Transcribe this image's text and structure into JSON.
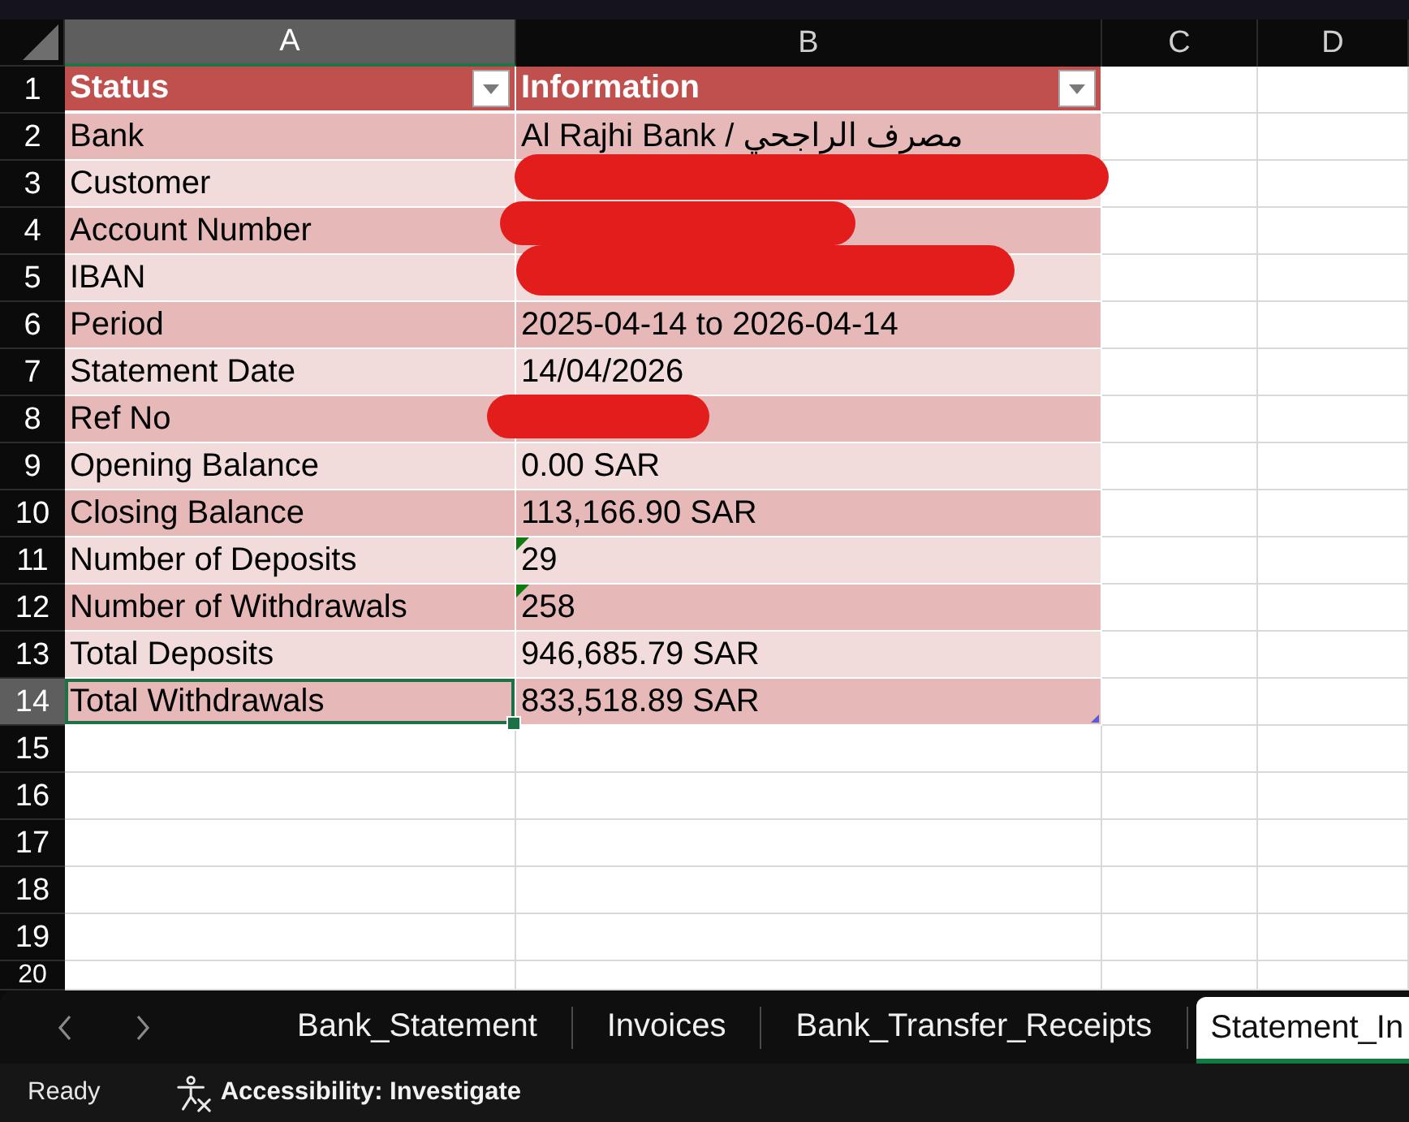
{
  "columns": [
    {
      "label": "A",
      "selected": true
    },
    {
      "label": "B",
      "selected": false
    },
    {
      "label": "C",
      "selected": false
    },
    {
      "label": "D",
      "selected": false
    }
  ],
  "rows": [
    {
      "kind": "header",
      "number": "1",
      "selected": false,
      "status": "Status",
      "information": "Information"
    },
    {
      "kind": "data",
      "number": "2",
      "selected": false,
      "status": "Bank",
      "information": "Al Rajhi Bank / مصرف الراجحي",
      "redacted": false,
      "number_as_text": false
    },
    {
      "kind": "data",
      "number": "3",
      "selected": false,
      "status": "Customer",
      "redacted": true,
      "number_as_text": false
    },
    {
      "kind": "data",
      "number": "4",
      "selected": false,
      "status": "Account Number",
      "redacted": true,
      "number_as_text": false
    },
    {
      "kind": "data",
      "number": "5",
      "selected": false,
      "status": "IBAN",
      "redacted": true,
      "number_as_text": false
    },
    {
      "kind": "data",
      "number": "6",
      "selected": false,
      "status": "Period",
      "information": "2025-04-14 to 2026-04-14",
      "redacted": false,
      "number_as_text": false
    },
    {
      "kind": "data",
      "number": "7",
      "selected": false,
      "status": "Statement Date",
      "information": "14/04/2026",
      "redacted": false,
      "number_as_text": false
    },
    {
      "kind": "data",
      "number": "8",
      "selected": false,
      "status": "Ref No",
      "redacted": true,
      "number_as_text": false
    },
    {
      "kind": "data",
      "number": "9",
      "selected": false,
      "status": "Opening Balance",
      "information": "0.00 SAR",
      "redacted": false,
      "number_as_text": false
    },
    {
      "kind": "data",
      "number": "10",
      "selected": false,
      "status": "Closing Balance",
      "information": "113,166.90 SAR",
      "redacted": false,
      "number_as_text": false
    },
    {
      "kind": "data",
      "number": "11",
      "selected": false,
      "status": "Number of Deposits",
      "information": "29",
      "redacted": false,
      "number_as_text": true
    },
    {
      "kind": "data",
      "number": "12",
      "selected": false,
      "status": "Number of Withdrawals",
      "information": "258",
      "redacted": false,
      "number_as_text": true
    },
    {
      "kind": "data",
      "number": "13",
      "selected": false,
      "status": "Total Deposits",
      "information": "946,685.79 SAR",
      "redacted": false,
      "number_as_text": false
    },
    {
      "kind": "data",
      "number": "14",
      "selected": true,
      "status": "Total Withdrawals",
      "information": "833,518.89 SAR",
      "redacted": false,
      "number_as_text": false
    },
    {
      "kind": "empty",
      "number": "15",
      "selected": false
    },
    {
      "kind": "empty",
      "number": "16",
      "selected": false
    },
    {
      "kind": "empty",
      "number": "17",
      "selected": false
    },
    {
      "kind": "empty",
      "number": "18",
      "selected": false
    },
    {
      "kind": "empty",
      "number": "19",
      "selected": false
    },
    {
      "kind": "empty",
      "number": "20",
      "selected": false
    }
  ],
  "sheet_tabs": [
    {
      "label": "Bank_Statement",
      "selected": false
    },
    {
      "label": "Invoices",
      "selected": false
    },
    {
      "label": "Bank_Transfer_Receipts",
      "selected": false
    },
    {
      "label": "Statement_In",
      "selected": true
    }
  ],
  "status_bar": {
    "mode": "Ready",
    "accessibility": "Accessibility: Investigate"
  }
}
